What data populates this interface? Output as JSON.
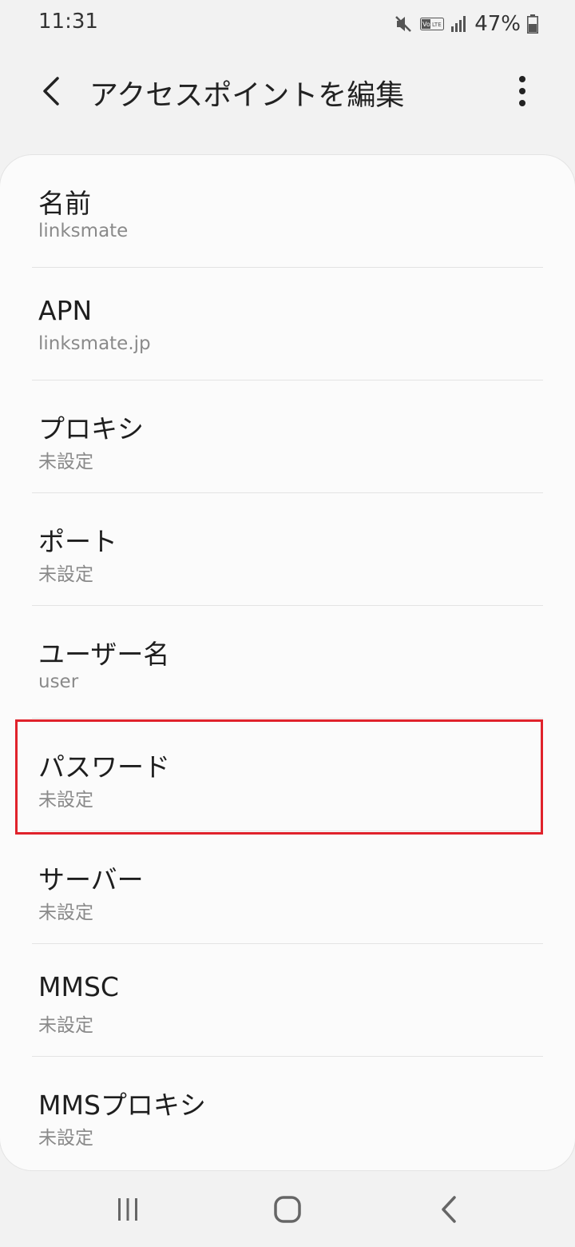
{
  "status_bar": {
    "time": "11:31",
    "battery": "47%",
    "icons": [
      "mute-icon",
      "volte-icon",
      "signal-icon",
      "battery-icon"
    ]
  },
  "app_bar": {
    "title": "アクセスポイントを編集",
    "back_icon": "chevron-left-icon",
    "more_icon": "more-vertical-icon"
  },
  "settings": [
    {
      "title": "名前",
      "value": "linksmate"
    },
    {
      "title": "APN",
      "value": "linksmate.jp"
    },
    {
      "title": "プロキシ",
      "value": "未設定"
    },
    {
      "title": "ポート",
      "value": "未設定"
    },
    {
      "title": "ユーザー名",
      "value": "user"
    },
    {
      "title": "パスワード",
      "value": "未設定"
    },
    {
      "title": "サーバー",
      "value": "未設定"
    },
    {
      "title": "MMSC",
      "value": "未設定"
    },
    {
      "title": "MMSプロキシ",
      "value": "未設定"
    }
  ],
  "highlight": {
    "target": "パスワード",
    "color": "#e0222b"
  },
  "nav_bar": {
    "icons": [
      "recent-apps-icon",
      "home-icon",
      "back-icon"
    ]
  }
}
